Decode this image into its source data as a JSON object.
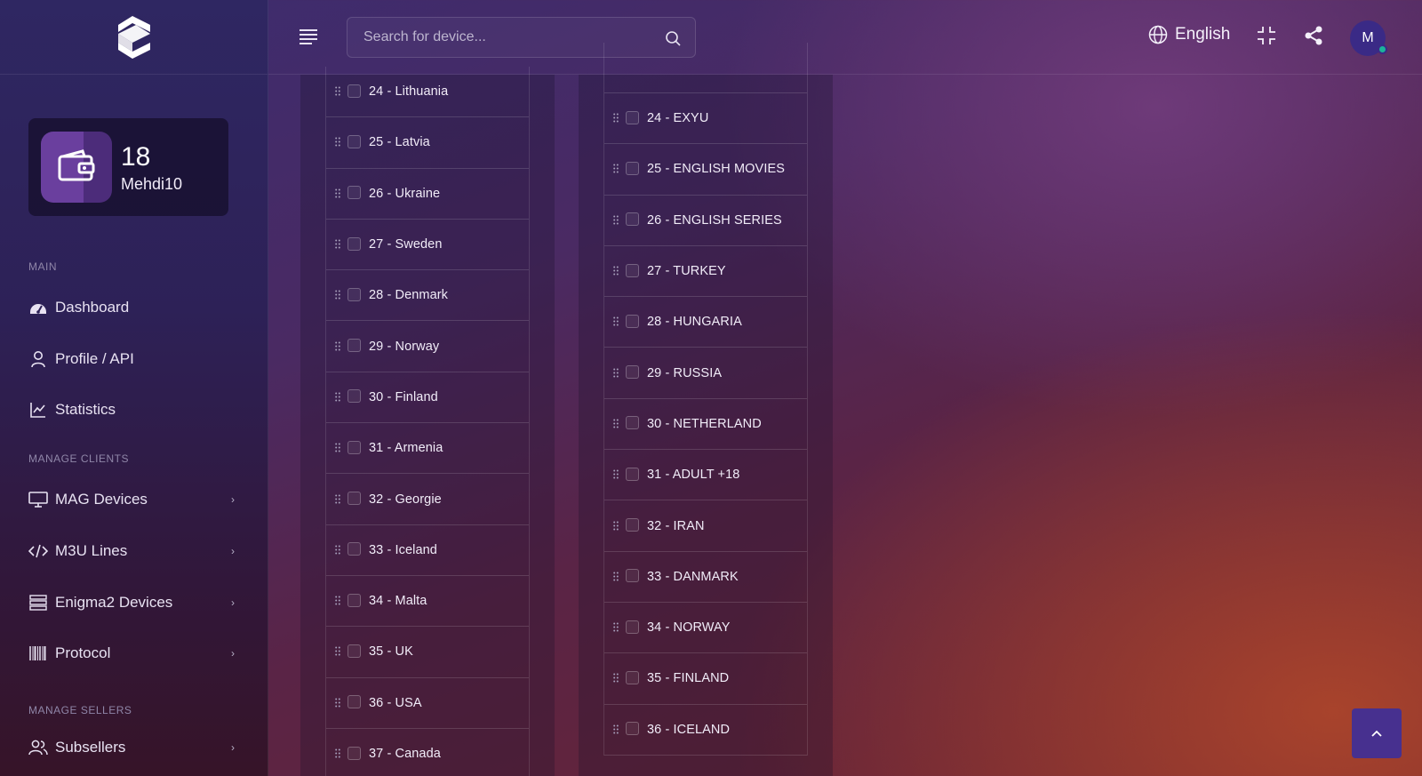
{
  "brand": {
    "logo": "logo-icon"
  },
  "wallet": {
    "balance": "18",
    "username": "Mehdi10",
    "icon": "wallet-icon"
  },
  "sidebar": {
    "sections": [
      "MAIN",
      "MANAGE CLIENTS",
      "MANAGE SELLERS"
    ],
    "items": [
      {
        "label": "Dashboard",
        "icon": "dashboard-icon"
      },
      {
        "label": "Profile / API",
        "icon": "user-icon"
      },
      {
        "label": "Statistics",
        "icon": "chart-icon"
      },
      {
        "label": "MAG Devices",
        "icon": "monitor-icon"
      },
      {
        "label": "M3U Lines",
        "icon": "code-icon"
      },
      {
        "label": "Enigma2 Devices",
        "icon": "server-icon"
      },
      {
        "label": "Protocol",
        "icon": "barcode-icon"
      },
      {
        "label": "Subsellers",
        "icon": "users-icon"
      }
    ]
  },
  "topbar": {
    "search_placeholder": "Search for device...",
    "language": "English",
    "avatar_initial": "M"
  },
  "bouquets_left": [
    "24 - Lithuania",
    "25 - Latvia",
    "26 - Ukraine",
    "27 - Sweden",
    "28 - Denmark",
    "29 - Norway",
    "30 - Finland",
    "31 - Armenia",
    "32 - Georgie",
    "33 - Iceland",
    "34 - Malta",
    "35 - UK",
    "36 - USA",
    "37 - Canada"
  ],
  "bouquets_right": [
    "24 - EXYU",
    "25 - ENGLISH MOVIES",
    "26 - ENGLISH SERIES",
    "27 - TURKEY",
    "28 - HUNGARIA",
    "29 - RUSSIA",
    "30 - NETHERLAND",
    "31 - ADULT +18",
    "32 - IRAN",
    "33 - DANMARK",
    "34 - NORWAY",
    "35 - FINLAND",
    "36 - ICELAND"
  ],
  "colors": {
    "accent": "#47308f",
    "online": "#1bb39a"
  }
}
